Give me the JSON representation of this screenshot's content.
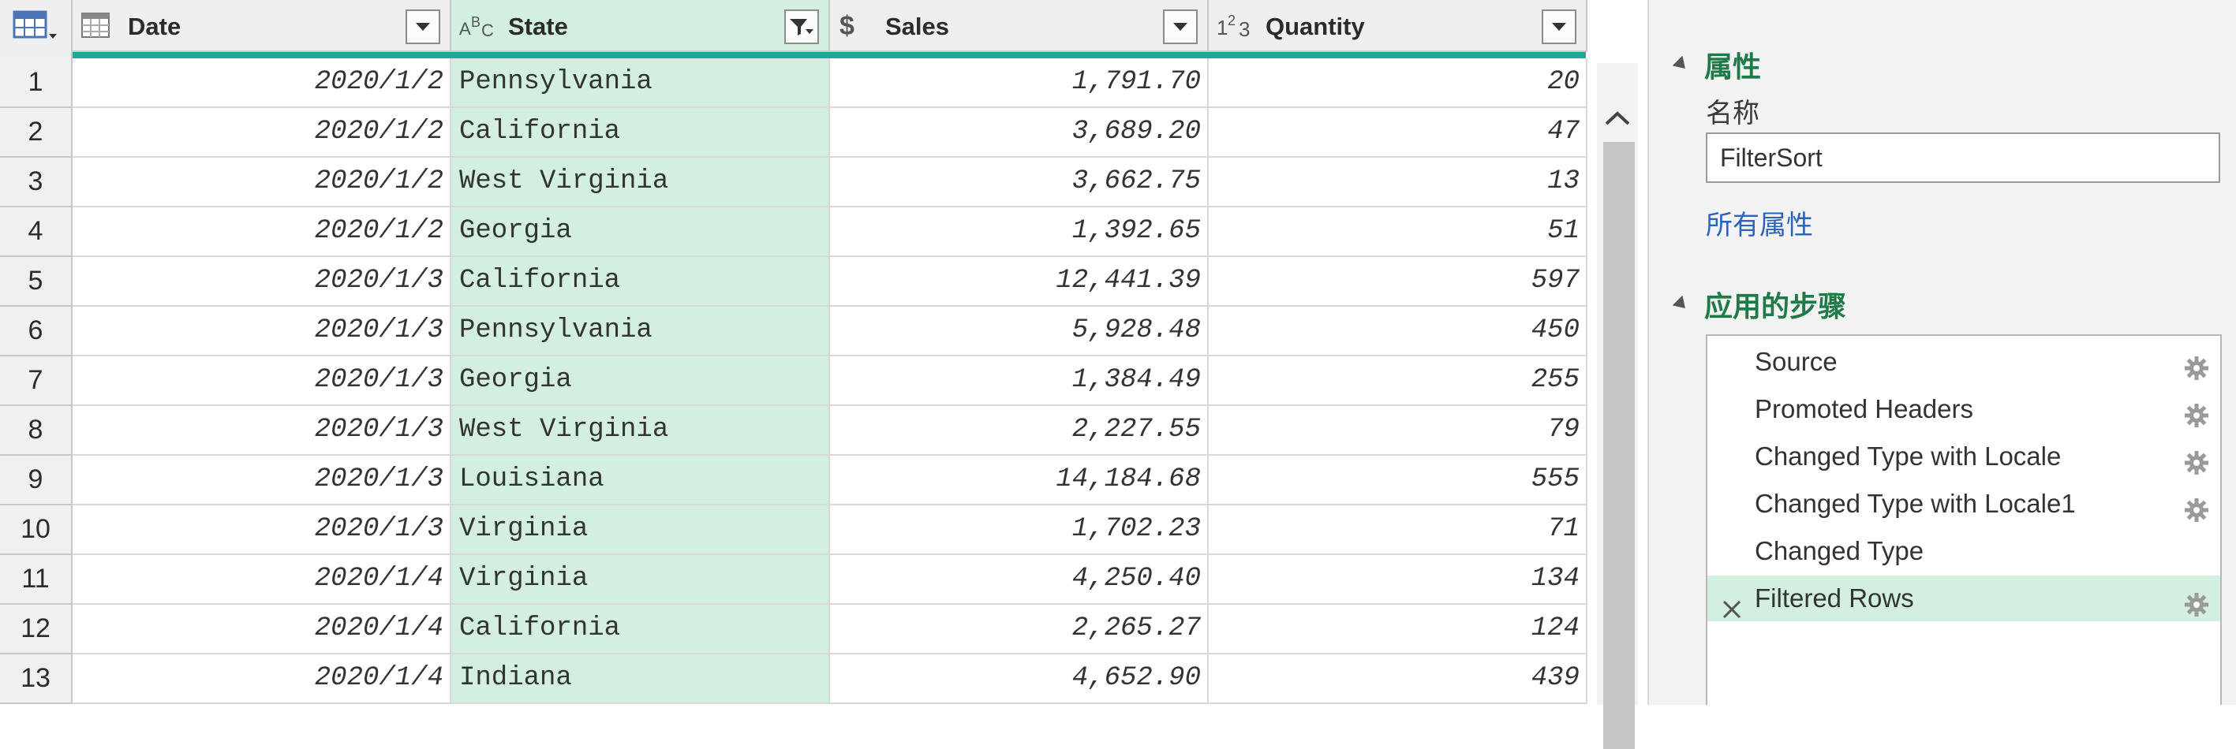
{
  "columns": [
    {
      "name": "Date",
      "icon": "calendar-table-icon"
    },
    {
      "name": "State",
      "icon": "abc-text-icon",
      "filtered": true
    },
    {
      "name": "Sales",
      "icon": "dollar-icon"
    },
    {
      "name": "Quantity",
      "icon": "number-123-icon"
    }
  ],
  "type_labels": {
    "text": "ABC",
    "number": "123",
    "currency": "$"
  },
  "rows": [
    {
      "n": "1",
      "date": "2020/1/2",
      "state": "Pennsylvania",
      "sales": "1,791.70",
      "qty": "20"
    },
    {
      "n": "2",
      "date": "2020/1/2",
      "state": "California",
      "sales": "3,689.20",
      "qty": "47"
    },
    {
      "n": "3",
      "date": "2020/1/2",
      "state": "West Virginia",
      "sales": "3,662.75",
      "qty": "13"
    },
    {
      "n": "4",
      "date": "2020/1/2",
      "state": "Georgia",
      "sales": "1,392.65",
      "qty": "51"
    },
    {
      "n": "5",
      "date": "2020/1/3",
      "state": "California",
      "sales": "12,441.39",
      "qty": "597"
    },
    {
      "n": "6",
      "date": "2020/1/3",
      "state": "Pennsylvania",
      "sales": "5,928.48",
      "qty": "450"
    },
    {
      "n": "7",
      "date": "2020/1/3",
      "state": "Georgia",
      "sales": "1,384.49",
      "qty": "255"
    },
    {
      "n": "8",
      "date": "2020/1/3",
      "state": "West Virginia",
      "sales": "2,227.55",
      "qty": "79"
    },
    {
      "n": "9",
      "date": "2020/1/3",
      "state": "Louisiana",
      "sales": "14,184.68",
      "qty": "555"
    },
    {
      "n": "10",
      "date": "2020/1/3",
      "state": "Virginia",
      "sales": "1,702.23",
      "qty": "71"
    },
    {
      "n": "11",
      "date": "2020/1/4",
      "state": "Virginia",
      "sales": "4,250.40",
      "qty": "134"
    },
    {
      "n": "12",
      "date": "2020/1/4",
      "state": "California",
      "sales": "2,265.27",
      "qty": "124"
    },
    {
      "n": "13",
      "date": "2020/1/4",
      "state": "Indiana",
      "sales": "4,652.90",
      "qty": "439"
    }
  ],
  "pane": {
    "properties_heading": "属性",
    "name_label": "名称",
    "name_value": "FilterSort",
    "all_properties_link": "所有属性",
    "steps_heading": "应用的步骤",
    "steps": [
      {
        "name": "Source",
        "gear": true,
        "active": false
      },
      {
        "name": "Promoted Headers",
        "gear": true,
        "active": false
      },
      {
        "name": "Changed Type with Locale",
        "gear": true,
        "active": false
      },
      {
        "name": "Changed Type with Locale1",
        "gear": true,
        "active": false
      },
      {
        "name": "Changed Type",
        "gear": false,
        "active": false
      },
      {
        "name": "Filtered Rows",
        "gear": true,
        "active": true
      }
    ]
  },
  "colors": {
    "accent": "#20a898",
    "selected_column": "#d2efe0",
    "heading_green": "#1e7a46",
    "link_blue": "#2a63b8"
  }
}
